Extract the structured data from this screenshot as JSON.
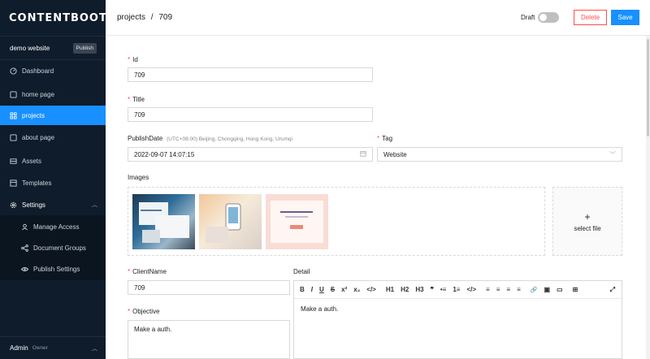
{
  "app": {
    "logo": "CONTENTBOOT"
  },
  "site": {
    "name": "demo website",
    "publish_label": "Publish"
  },
  "sidebar": {
    "items": [
      {
        "label": "Dashboard",
        "icon": "dashboard-icon"
      },
      {
        "label": "home page",
        "icon": "page-icon"
      },
      {
        "label": "projects",
        "icon": "grid-icon",
        "active": true
      },
      {
        "label": "about page",
        "icon": "page-icon"
      },
      {
        "label": "Assets",
        "icon": "assets-icon"
      },
      {
        "label": "Templates",
        "icon": "templates-icon"
      },
      {
        "label": "Settings",
        "icon": "gear-icon",
        "expanded": true
      }
    ],
    "settings_sub": [
      {
        "label": "Manage Access",
        "icon": "user-icon"
      },
      {
        "label": "Document Groups",
        "icon": "share-icon"
      },
      {
        "label": "Publish Settings",
        "icon": "eye-icon"
      }
    ],
    "user": {
      "name": "Admin",
      "role": "Owner"
    }
  },
  "header": {
    "breadcrumb_section": "projects",
    "breadcrumb_sep": "/",
    "breadcrumb_item": "709",
    "draft_label": "Draft",
    "draft_on": false,
    "delete_label": "Delete",
    "save_label": "Save"
  },
  "form": {
    "id": {
      "label": "Id",
      "value": "709"
    },
    "title": {
      "label": "Title",
      "value": "709"
    },
    "publish_date": {
      "label": "PublishDate",
      "timezone": "(UTC+08:00) Beijing, Chongqing, Hong Kong, Urumqi",
      "value": "2022-09-07 14:07:15"
    },
    "tag": {
      "label": "Tag",
      "value": "Website"
    },
    "images": {
      "label": "Images",
      "count": 3,
      "select_label": "select file",
      "plus": "+"
    },
    "client_name": {
      "label": "ClientName",
      "value": "709"
    },
    "objective": {
      "label": "Objective",
      "value": "Make a auth."
    },
    "detail": {
      "label": "Detail",
      "value": "Make a auth."
    }
  },
  "toolbar": [
    "B",
    "I",
    "U",
    "S",
    "x²",
    "x₂",
    "</>",
    "H1",
    "H2",
    "H3",
    "❞",
    "•≡",
    "1≡",
    "</>",
    "≡",
    "≡",
    "≡",
    "≡",
    "🔗",
    "▣",
    "▭",
    "⊞",
    "⤢"
  ],
  "colors": {
    "sidebar_bg": "#0f1c2b",
    "accent": "#1890ff",
    "danger": "#ff4d4f"
  }
}
